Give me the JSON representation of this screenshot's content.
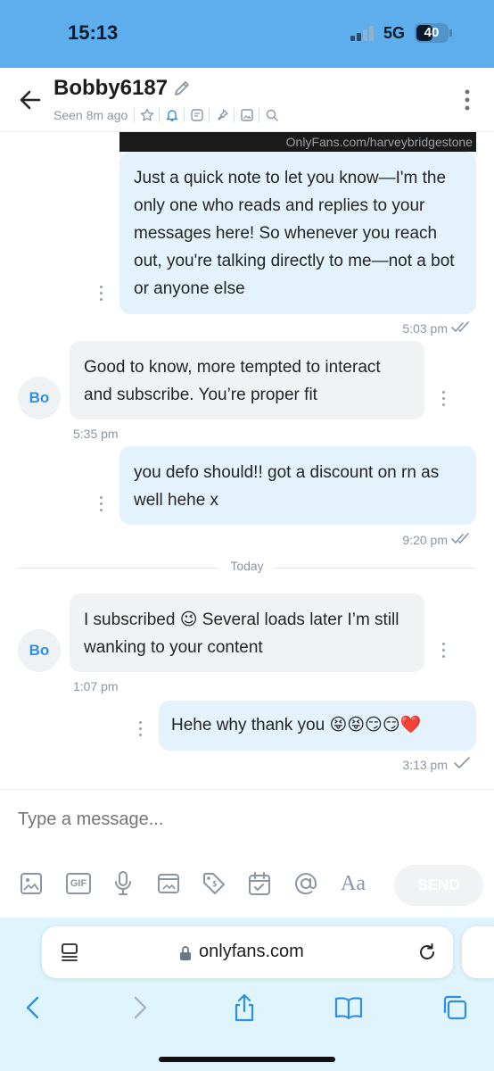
{
  "status_bar": {
    "time": "15:13",
    "network": "5G",
    "battery": "40"
  },
  "header": {
    "username": "Bobby6187",
    "seen": "Seen 8m ago",
    "icons": [
      "star-icon",
      "bell-icon",
      "note-icon",
      "pin-icon",
      "image-icon",
      "search-icon"
    ]
  },
  "watermark": "OnlyFans.com/harveybridgestone",
  "messages": [
    {
      "direction": "out",
      "text": "Just a quick note to let you know—I'm the only one who reads and replies to your messages here! So whenever you reach out, you're talking directly to me—not a bot or anyone else",
      "time": "5:03 pm",
      "status": "read"
    },
    {
      "direction": "in",
      "avatar": "Bo",
      "text": "Good to know, more tempted to interact and subscribe. You’re proper fit",
      "time": "5:35 pm"
    },
    {
      "direction": "out",
      "text": "you defo should!! got a discount on rn as well hehe x",
      "time": "9:20 pm",
      "status": "read"
    },
    {
      "direction": "in",
      "avatar": "Bo",
      "text": "I subscribed 😉 Several loads later I’m still wanking to your content",
      "time": "1:07 pm"
    },
    {
      "direction": "out",
      "text": "Hehe why thank you 😝😝😏😏❤️",
      "time": "3:13 pm",
      "status": "sent"
    }
  ],
  "day_separator": "Today",
  "composer": {
    "placeholder": "Type a message...",
    "tools": [
      "image-icon",
      "gif-icon",
      "microphone-icon",
      "media-vault-icon",
      "price-tag-icon",
      "calendar-icon",
      "at-sign-icon",
      "text-format-icon"
    ],
    "gif_label": "GIF",
    "text_label": "Aa",
    "send_label": "SEND"
  },
  "browser": {
    "url": "onlyfans.com",
    "buttons": [
      "back-icon",
      "forward-icon",
      "share-icon",
      "bookmarks-icon",
      "tabs-icon"
    ]
  }
}
